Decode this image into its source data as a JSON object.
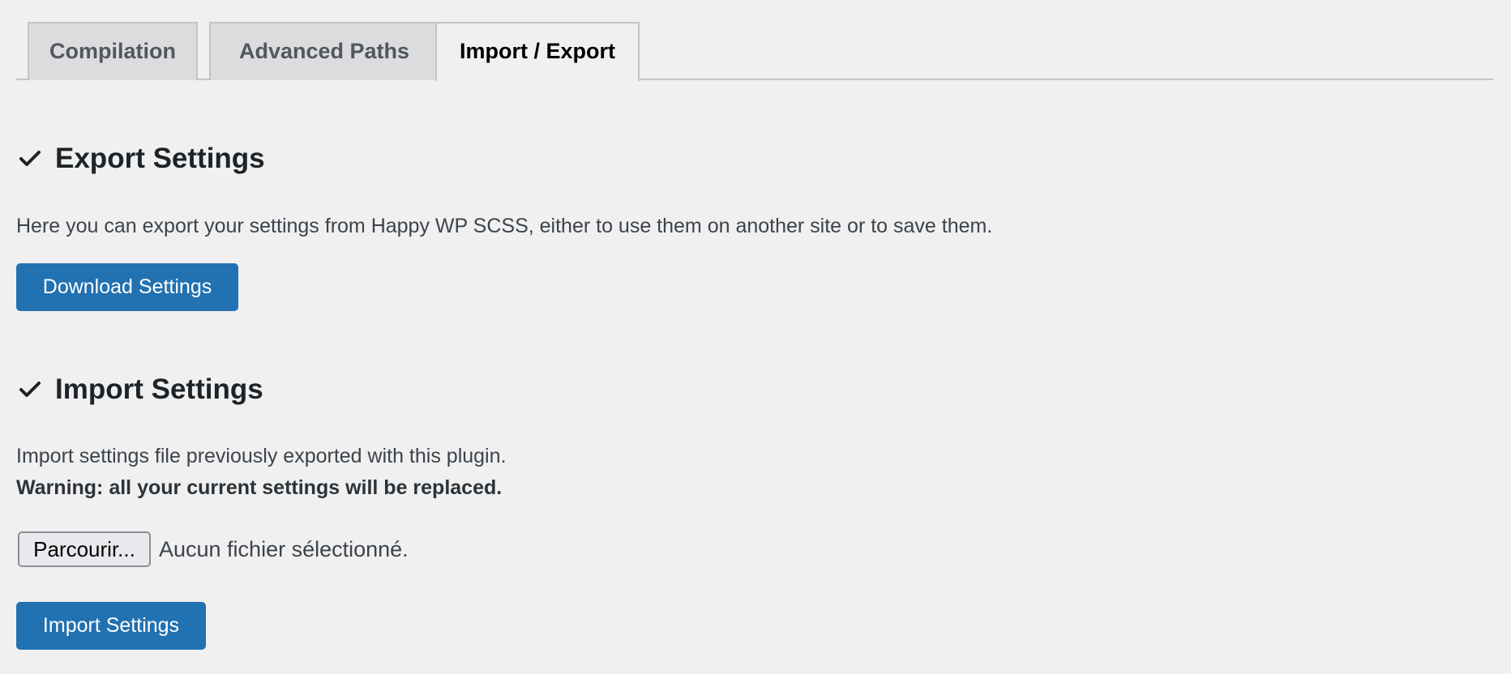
{
  "tabs": {
    "compilation": "Compilation",
    "advanced_paths": "Advanced Paths",
    "import_export": "Import / Export",
    "active": "import_export"
  },
  "export_section": {
    "title": "Export Settings",
    "icon": "check-icon",
    "description": "Here you can export your settings from Happy WP SCSS, either to use them on another site or to save them.",
    "button_label": "Download Settings"
  },
  "import_section": {
    "title": "Import Settings",
    "icon": "check-icon",
    "description": "Import settings file previously exported with this plugin.",
    "warning": "Warning: all your current settings will be replaced.",
    "file_button_label": "Parcourir...",
    "file_status": "Aucun fichier sélectionné.",
    "button_label": "Import Settings"
  },
  "colors": {
    "primary": "#2271b1",
    "background": "#f0f0f1",
    "tab_inactive": "#dcdcde"
  }
}
